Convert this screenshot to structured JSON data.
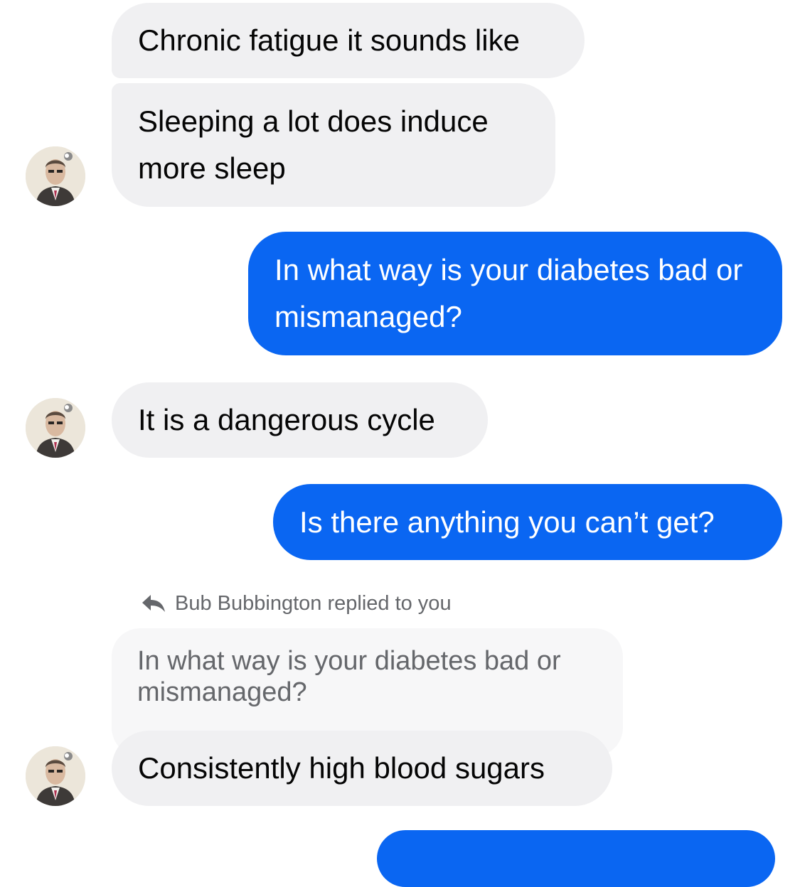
{
  "conversation": {
    "messages": [
      {
        "direction": "incoming",
        "text": "Chronic fatigue it sounds like"
      },
      {
        "direction": "incoming",
        "text": "Sleeping a lot does induce more sleep"
      },
      {
        "direction": "outgoing",
        "text": "In what way is your diabetes bad or mismanaged?"
      },
      {
        "direction": "incoming",
        "text": "It is a dangerous cycle"
      },
      {
        "direction": "outgoing",
        "text": "Is there anything you can’t get?"
      },
      {
        "direction": "incoming",
        "text": "Consistently high blood sugars"
      }
    ],
    "reply": {
      "header": "Bub Bubbington replied to you",
      "quoted_text": "In what way is your diabetes bad or mismanaged?"
    }
  },
  "colors": {
    "outgoing_bubble": "#0a66f2",
    "incoming_bubble": "#f0f0f2",
    "quoted_bubble": "#f7f7f8",
    "meta_text": "#65676b"
  },
  "icons": {
    "reply": "reply-arrow-icon",
    "avatar": "contact-avatar"
  }
}
